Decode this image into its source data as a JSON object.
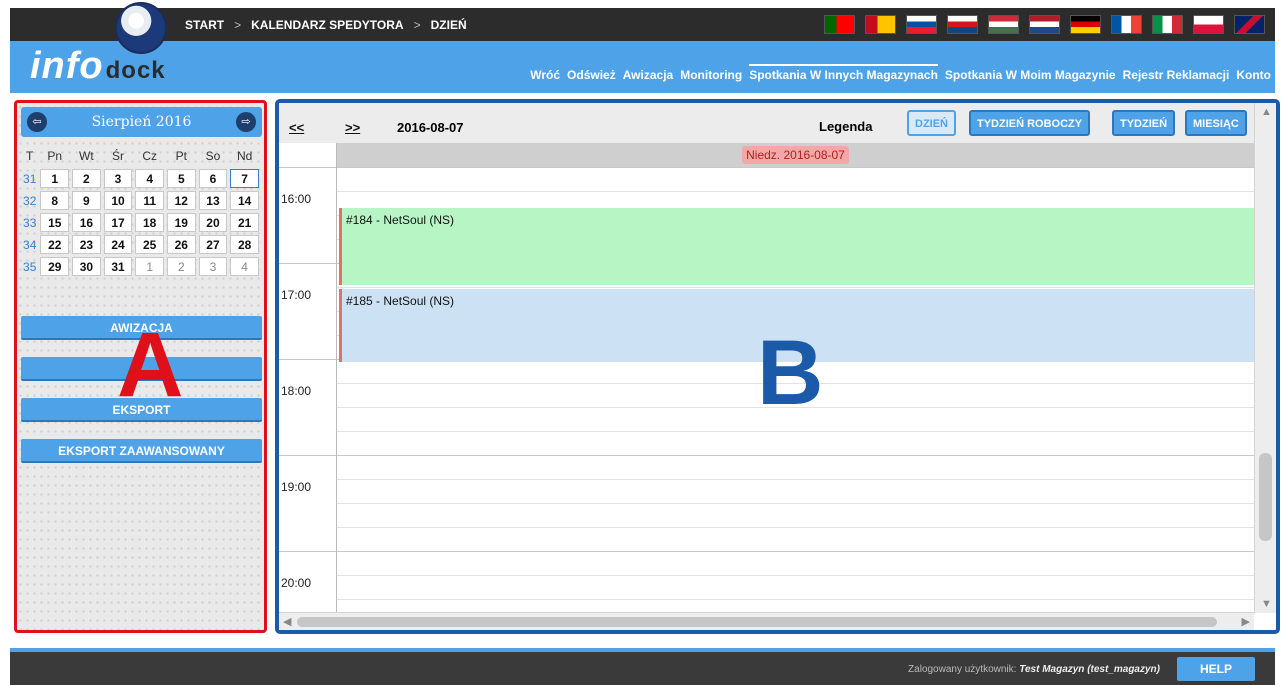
{
  "breadcrumb": {
    "start": "START",
    "sep1": ">",
    "calendar": "KALENDARZ SPEDYTORA",
    "sep2": ">",
    "day": "DZIEŃ"
  },
  "brand": {
    "info": "info",
    "dock": "dock"
  },
  "flags": [
    {
      "name": "flag-portugal-icon",
      "colors": [
        "#006600",
        "#ff0000"
      ]
    },
    {
      "name": "flag-spain-icon",
      "colors": [
        "#c60b1e",
        "#ffc400"
      ]
    },
    {
      "name": "flag-slovakia-icon",
      "colors": [
        "#ffffff",
        "#0b4ea2",
        "#ee1c25"
      ]
    },
    {
      "name": "flag-czech-icon",
      "colors": [
        "#ffffff",
        "#d7141a",
        "#11457e"
      ]
    },
    {
      "name": "flag-hungary-icon",
      "colors": [
        "#ce2939",
        "#ffffff",
        "#477050"
      ]
    },
    {
      "name": "flag-netherlands-icon",
      "colors": [
        "#ae1c28",
        "#ffffff",
        "#21468b"
      ]
    },
    {
      "name": "flag-germany-icon",
      "colors": [
        "#000000",
        "#dd0000",
        "#ffce00"
      ]
    },
    {
      "name": "flag-france-icon",
      "colors": [
        "#0055a4",
        "#ffffff",
        "#ef4135"
      ]
    },
    {
      "name": "flag-italy-icon",
      "colors": [
        "#009246",
        "#ffffff",
        "#ce2b37"
      ]
    },
    {
      "name": "flag-poland-icon",
      "colors": [
        "#ffffff",
        "#dc143c"
      ]
    },
    {
      "name": "flag-uk-icon",
      "colors": [
        "#012169",
        "#ffffff",
        "#c8102e"
      ]
    }
  ],
  "nav": {
    "back": "Wróć",
    "refresh": "Odśwież",
    "advice": "Awizacja",
    "monitoring": "Monitoring",
    "other_warehouses": "Spotkania W Innych Magazynach",
    "my_warehouse": "Spotkania W Moim Magazynie",
    "complaints": "Rejestr Reklamacji",
    "account": "Konto"
  },
  "calendar": {
    "month_title": "Sierpień 2016",
    "prev_icon": "⇦",
    "next_icon": "⇨",
    "weekdays": [
      "T",
      "Pn",
      "Wt",
      "Śr",
      "Cz",
      "Pt",
      "So",
      "Nd"
    ],
    "weeks": [
      {
        "wk": "31",
        "days": [
          "1",
          "2",
          "3",
          "4",
          "5",
          "6",
          "7"
        ]
      },
      {
        "wk": "32",
        "days": [
          "8",
          "9",
          "10",
          "11",
          "12",
          "13",
          "14"
        ]
      },
      {
        "wk": "33",
        "days": [
          "15",
          "16",
          "17",
          "18",
          "19",
          "20",
          "21"
        ]
      },
      {
        "wk": "34",
        "days": [
          "22",
          "23",
          "24",
          "25",
          "26",
          "27",
          "28"
        ]
      },
      {
        "wk": "35",
        "days": [
          "29",
          "30",
          "31",
          "1",
          "2",
          "3",
          "4"
        ]
      }
    ]
  },
  "left_buttons": {
    "advice": "AWIZACJA",
    "second": "",
    "export": "EKSPORT",
    "export_advanced": "EKSPORT ZAAWANSOWANY"
  },
  "annotation_marks": {
    "left": "A",
    "right": "B",
    "left_color": "#e0101a",
    "right_color": "#1a5aa8"
  },
  "schedule": {
    "prev": "<<",
    "next": ">>",
    "current_date": "2016-08-07",
    "legend": "Legenda",
    "views": {
      "day": "DZIEŃ",
      "workweek": "TYDZIEŃ ROBOCZY",
      "week": "TYDZIEŃ",
      "month": "MIESIĄC"
    },
    "day_header": "Niedz. 2016-08-07",
    "hours": [
      "16:00",
      "17:00",
      "18:00",
      "19:00",
      "20:00"
    ],
    "events": [
      {
        "label": "#184 - NetSoul (NS)",
        "color": "#b7f5c5"
      },
      {
        "label": "#185 - NetSoul (NS)",
        "color": "#cce2f4"
      }
    ]
  },
  "footer": {
    "logged_label": "Zalogowany użytkownik:",
    "user": "Test Magazyn (test_magazyn)",
    "help": "HELP"
  }
}
